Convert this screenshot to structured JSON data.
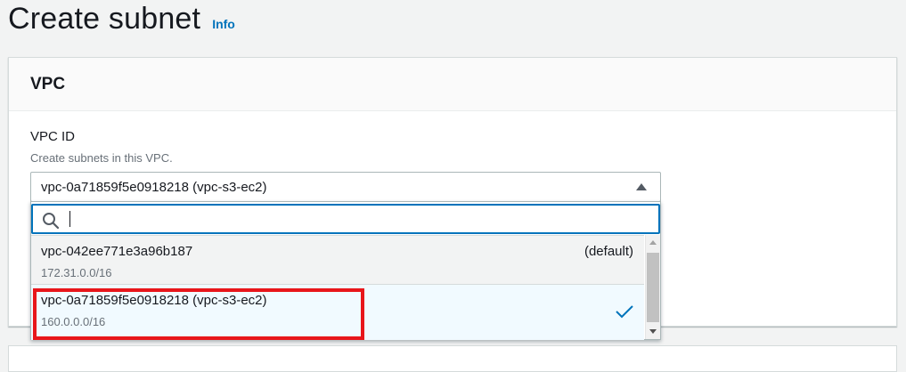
{
  "header": {
    "title": "Create subnet",
    "info_label": "Info"
  },
  "vpc_section": {
    "title": "VPC",
    "field_label": "VPC ID",
    "field_description": "Create subnets in this VPC.",
    "selected_value": "vpc-0a71859f5e0918218 (vpc-s3-ec2)",
    "search": {
      "value": "",
      "placeholder": ""
    },
    "options": [
      {
        "label": "vpc-042ee771e3a96b187",
        "cidr": "172.31.0.0/16",
        "tag": "(default)",
        "selected": false
      },
      {
        "label": "vpc-0a71859f5e0918218 (vpc-s3-ec2)",
        "cidr": "160.0.0.0/16",
        "tag": "",
        "selected": true
      }
    ]
  },
  "colors": {
    "accent": "#0073bb",
    "highlight": "#e8161b",
    "selected_bg": "#f1faff"
  }
}
